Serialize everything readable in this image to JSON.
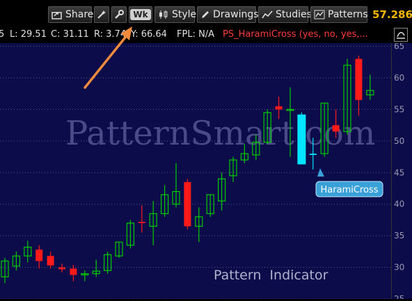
{
  "toolbar": {
    "share_label": "Share",
    "wk_label": "Wk",
    "style_label": "Style",
    "drawings_label": "Drawings",
    "studies_label": "Studies",
    "patterns_label": "Patterns",
    "price": "57.2863"
  },
  "infobar": {
    "left_fragment": "5",
    "low": "L: 29.51",
    "close": "C: 31.11",
    "range": "R: 3.74",
    "y": "Y: 66.64",
    "fpl": "FPL: N/A",
    "study": "PS_HaramiCross (yes, no, yes,..."
  },
  "colors": {
    "background": "#0c0c4a",
    "up_candle": "#00cc00",
    "down_candle": "#ff1a1a",
    "highlight": "#00e5ff",
    "price": "#f2b500",
    "arrow": "#f08a3c"
  },
  "chart_data": {
    "type": "candlestick",
    "y_ticks": [
      "25",
      "30",
      "35",
      "40",
      "45",
      "50",
      "55",
      "60",
      "65"
    ],
    "ylim": [
      25,
      65.5
    ],
    "candles": [
      {
        "o": 28.5,
        "h": 31.5,
        "l": 27.5,
        "c": 31,
        "dir": "up"
      },
      {
        "o": 30.2,
        "h": 32.5,
        "l": 29.5,
        "c": 31.8,
        "dir": "up"
      },
      {
        "o": 31.8,
        "h": 34.2,
        "l": 30.8,
        "c": 33.2,
        "dir": "up"
      },
      {
        "o": 32.8,
        "h": 33.5,
        "l": 29.8,
        "c": 31.0,
        "dir": "down"
      },
      {
        "o": 31.8,
        "h": 32.5,
        "l": 29.8,
        "c": 30.3,
        "dir": "down"
      },
      {
        "o": 30.0,
        "h": 30.6,
        "l": 29.2,
        "c": 29.7,
        "dir": "down"
      },
      {
        "o": 29.8,
        "h": 30.4,
        "l": 27.8,
        "c": 28.8,
        "dir": "down"
      },
      {
        "o": 28.8,
        "h": 29.5,
        "l": 27.8,
        "c": 29.0,
        "dir": "up"
      },
      {
        "o": 29.0,
        "h": 31.2,
        "l": 28.5,
        "c": 29.4,
        "dir": "up"
      },
      {
        "o": 29.5,
        "h": 32.5,
        "l": 29.0,
        "c": 32.0,
        "dir": "up"
      },
      {
        "o": 31.8,
        "h": 34.0,
        "l": 31.5,
        "c": 34.0,
        "dir": "up"
      },
      {
        "o": 33.5,
        "h": 37.5,
        "l": 33.0,
        "c": 37.0,
        "dir": "up"
      },
      {
        "o": 37.2,
        "h": 39.8,
        "l": 35.5,
        "c": 37.0,
        "dir": "down"
      },
      {
        "o": 36.5,
        "h": 40.5,
        "l": 33.5,
        "c": 38.5,
        "dir": "up"
      },
      {
        "o": 38.5,
        "h": 43.0,
        "l": 38.0,
        "c": 41.5,
        "dir": "up"
      },
      {
        "o": 40.0,
        "h": 46.5,
        "l": 39.5,
        "c": 42.0,
        "dir": "up"
      },
      {
        "o": 43.5,
        "h": 44.0,
        "l": 36.0,
        "c": 36.5,
        "dir": "down"
      },
      {
        "o": 36.5,
        "h": 39.5,
        "l": 34.0,
        "c": 38.0,
        "dir": "up"
      },
      {
        "o": 38.5,
        "h": 41.5,
        "l": 38.0,
        "c": 41.5,
        "dir": "up"
      },
      {
        "o": 40.5,
        "h": 45.0,
        "l": 39.0,
        "c": 44.0,
        "dir": "up"
      },
      {
        "o": 44.5,
        "h": 47.5,
        "l": 43.5,
        "c": 47.0,
        "dir": "up"
      },
      {
        "o": 47.0,
        "h": 49.5,
        "l": 46.5,
        "c": 48.0,
        "dir": "up"
      },
      {
        "o": 47.8,
        "h": 51.0,
        "l": 47.0,
        "c": 49.8,
        "dir": "up"
      },
      {
        "o": 49.8,
        "h": 55.0,
        "l": 49.5,
        "c": 54.5,
        "dir": "up"
      },
      {
        "o": 55.5,
        "h": 57.0,
        "l": 53.5,
        "c": 55.0,
        "dir": "down"
      },
      {
        "o": 55.0,
        "h": 58.5,
        "l": 47.5,
        "c": 55.0,
        "dir": "up"
      },
      {
        "o": 54.2,
        "h": 54.5,
        "l": 46.3,
        "c": 46.3,
        "dir": "highlight"
      },
      {
        "o": 47.8,
        "h": 50.5,
        "l": 45.5,
        "c": 48.0,
        "dir": "highlight"
      },
      {
        "o": 48.0,
        "h": 56.0,
        "l": 47.5,
        "c": 56.0,
        "dir": "up"
      },
      {
        "o": 52.5,
        "h": 55.0,
        "l": 50.5,
        "c": 51.5,
        "dir": "down"
      },
      {
        "o": 51.5,
        "h": 63.0,
        "l": 51.0,
        "c": 62.0,
        "dir": "up"
      },
      {
        "o": 63.0,
        "h": 63.5,
        "l": 54.0,
        "c": 56.5,
        "dir": "down"
      },
      {
        "o": 57.3,
        "h": 60.5,
        "l": 56.5,
        "c": 58.0,
        "dir": "up"
      }
    ],
    "watermark": "PatternSmart.com",
    "annotation": "HaramiCross",
    "footer_label": "Pattern  Indicator"
  }
}
